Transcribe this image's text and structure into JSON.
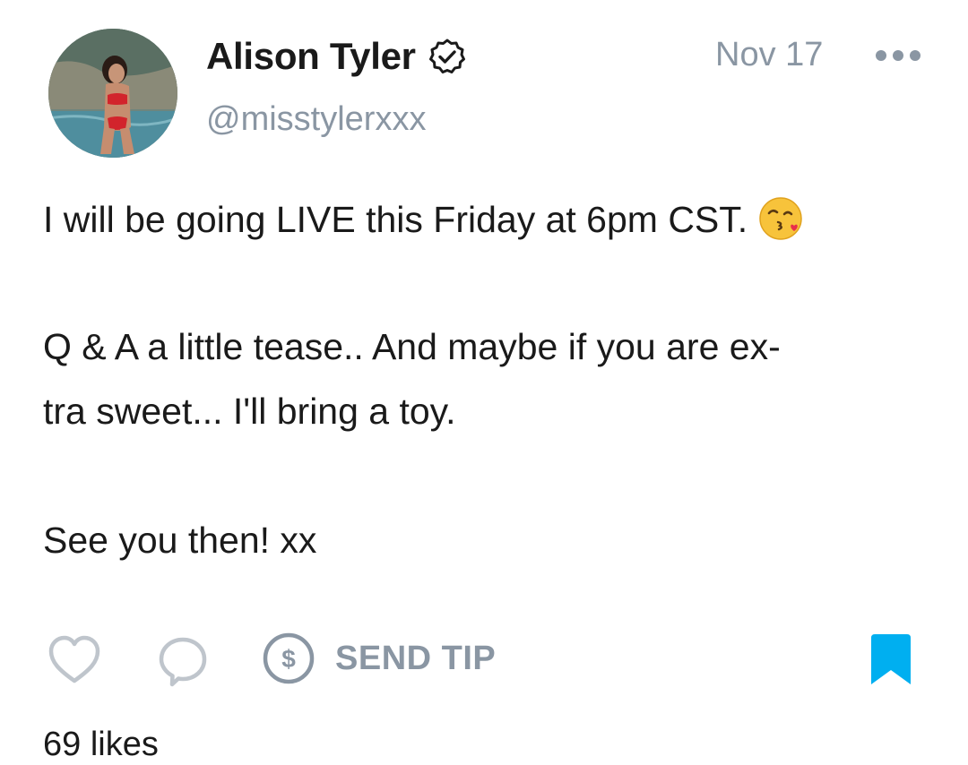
{
  "author": {
    "display_name": "Alison Tyler",
    "handle": "@misstylerxxx",
    "verified": true
  },
  "post": {
    "date": "Nov 17",
    "lines": [
      "I will be going LIVE this Friday at 6pm CST.",
      "Q & A a little tease.. And maybe if you are ex-",
      "tra sweet... I'll bring a toy.",
      "See you then! xx"
    ],
    "emoji": "kissing-face-with-heart-emoji"
  },
  "actions": {
    "send_tip_label": "SEND TIP"
  },
  "stats": {
    "likes_text": "69 likes"
  },
  "colors": {
    "accent": "#00aff0",
    "muted": "#8a96a3",
    "text": "#1a1a1a"
  }
}
